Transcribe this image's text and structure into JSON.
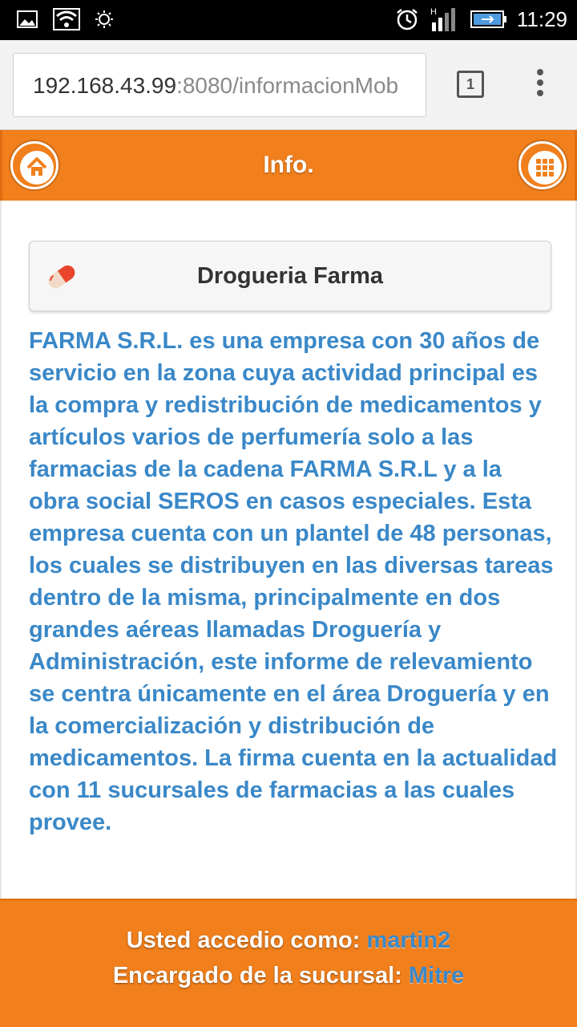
{
  "status_bar": {
    "time": "11:29",
    "network_type": "H",
    "icons": [
      "gallery-icon",
      "wifi-icon",
      "brightness-icon",
      "alarm-icon",
      "signal-icon",
      "battery-icon"
    ]
  },
  "browser": {
    "url_host": "192.168.43.99",
    "url_rest": ":8080/informacionMob",
    "tab_count": "1"
  },
  "header": {
    "title": "Info.",
    "accent_color": "#f07f1c"
  },
  "company": {
    "name": "Drogueria Farma"
  },
  "info": {
    "text": "FARMA S.R.L. es una empresa con 30 años de servicio en la zona cuya actividad principal es la compra y redistribución de medicamentos y artículos varios de perfumería solo a las farmacias de la cadena FARMA S.R.L y a la obra social SEROS en casos especiales. Esta empresa cuenta con un plantel de 48 personas, los cuales se distribuyen en las diversas tareas dentro de la misma, principalmente en dos grandes aéreas llamadas Droguería y Administración, este informe de relevamiento se centra únicamente en el área Droguería y en la comercialización y distribución de medicamentos. La firma cuenta en la actualidad con 11 sucursales de farmacias a las cuales provee.",
    "text_color": "#3a88c8"
  },
  "footer": {
    "user_label": "Usted accedio como: ",
    "user_value": "martin2",
    "branch_label": "Encargado de la sucursal: ",
    "branch_value": "Mitre"
  }
}
